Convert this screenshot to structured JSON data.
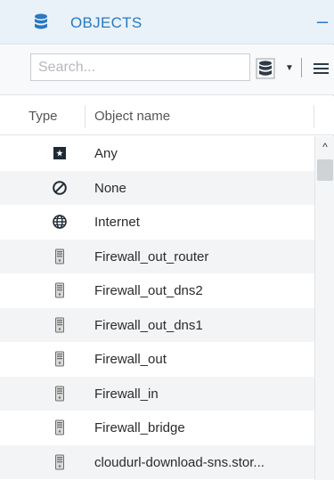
{
  "header": {
    "title": "OBJECTS",
    "icon": "database-icon",
    "collapse_glyph": "–",
    "accent_color": "#2a78bf"
  },
  "toolbar": {
    "search_placeholder": "Search...",
    "db_icon": "database-filter-icon",
    "caret_glyph": "▼",
    "menu_icon": "menu-icon"
  },
  "table": {
    "columns": [
      "Type",
      "Object name"
    ],
    "rows": [
      {
        "icon": "any-icon",
        "name": "Any"
      },
      {
        "icon": "none-icon",
        "name": "None"
      },
      {
        "icon": "globe-icon",
        "name": "Internet"
      },
      {
        "icon": "host-icon",
        "name": "Firewall_out_router"
      },
      {
        "icon": "host-icon",
        "name": "Firewall_out_dns2"
      },
      {
        "icon": "host-icon",
        "name": "Firewall_out_dns1"
      },
      {
        "icon": "host-icon",
        "name": "Firewall_out"
      },
      {
        "icon": "host-icon",
        "name": "Firewall_in"
      },
      {
        "icon": "host-icon",
        "name": "Firewall_bridge"
      },
      {
        "icon": "host-icon",
        "name": "cloudurl-download-sns.stor..."
      }
    ]
  },
  "scrollbar": {
    "up_glyph": "^"
  }
}
